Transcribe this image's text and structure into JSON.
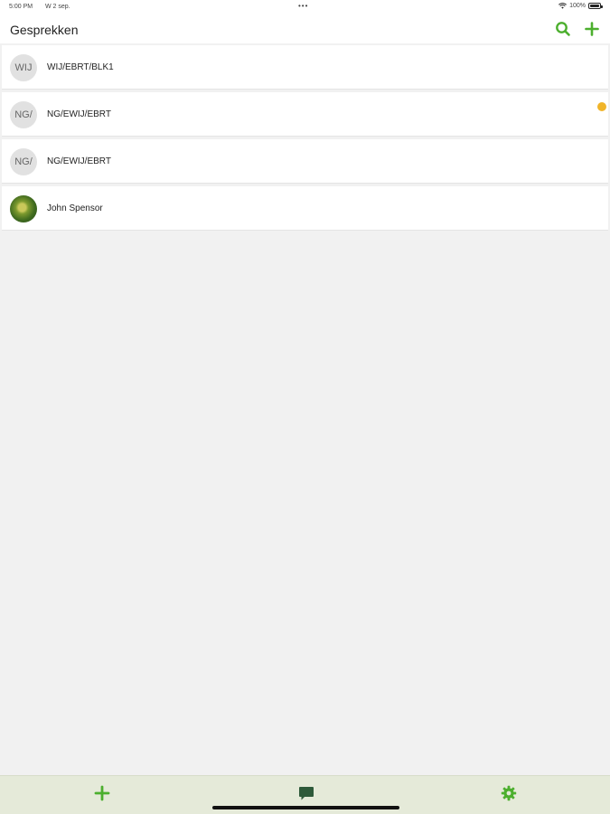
{
  "status_bar": {
    "time": "5:00 PM",
    "date": "W 2 sep.",
    "dots": "•••",
    "battery": "100%"
  },
  "header": {
    "title": "Gesprekken",
    "search_icon": "search-icon",
    "add_icon": "plus-icon"
  },
  "conversations": [
    {
      "initials": "WIJ",
      "name": "WIJ/EBRT/BLK1",
      "unread": false,
      "avatar": "initials"
    },
    {
      "initials": "NG/",
      "name": "NG/EWIJ/EBRT",
      "unread": true,
      "avatar": "initials"
    },
    {
      "initials": "NG/",
      "name": "NG/EWIJ/EBRT",
      "unread": false,
      "avatar": "initials"
    },
    {
      "initials": "",
      "name": "John Spensor",
      "unread": false,
      "avatar": "photo"
    }
  ],
  "tab_bar": {
    "tabs": [
      {
        "icon": "plus-icon"
      },
      {
        "icon": "chat-icon"
      },
      {
        "icon": "gear-icon"
      }
    ]
  },
  "colors": {
    "accent_green": "#4caf2e",
    "dark_green": "#2e5a3a",
    "unread_dot": "#f0b429",
    "tab_bar_bg": "#e5ead9",
    "list_bg": "#f1f1f1"
  }
}
